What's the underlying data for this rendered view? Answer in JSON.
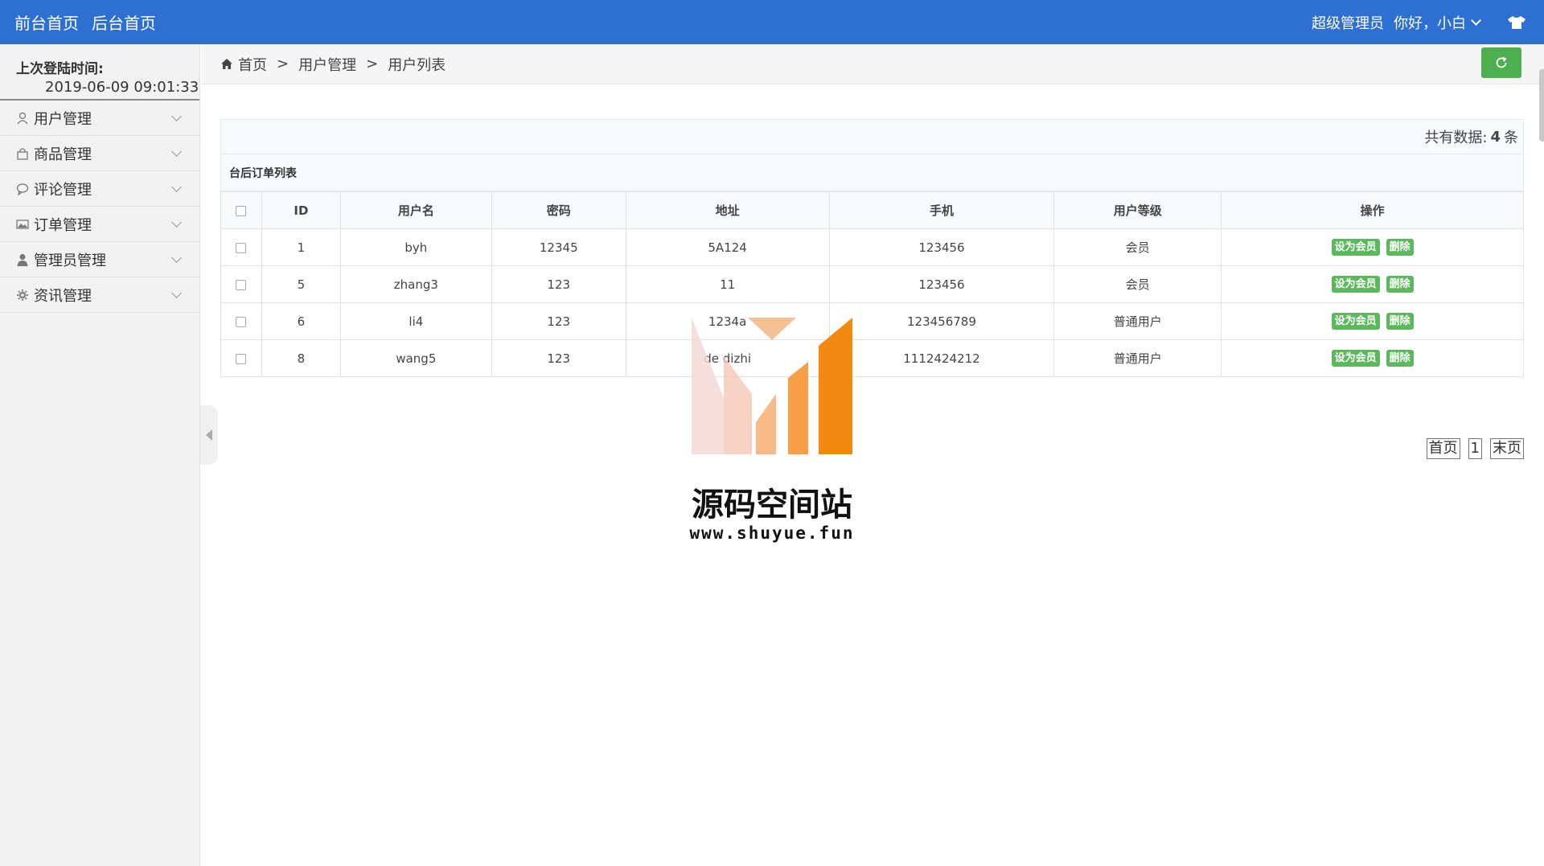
{
  "topbar": {
    "links": [
      "前台首页",
      "后台首页"
    ],
    "role": "超级管理员",
    "greeting": "你好，小白",
    "icons": {
      "user_menu": "chevron-down-icon",
      "theme": "tshirt-icon"
    },
    "color": "#2e70d1"
  },
  "sidebar": {
    "login_label": "上次登陆时间:",
    "login_time": "2019-06-09 09:01:33",
    "items": [
      {
        "label": "用户管理",
        "icon": "user-icon"
      },
      {
        "label": "商品管理",
        "icon": "bag-icon"
      },
      {
        "label": "评论管理",
        "icon": "chat-icon"
      },
      {
        "label": "订单管理",
        "icon": "image-icon"
      },
      {
        "label": "管理员管理",
        "icon": "person-icon"
      },
      {
        "label": "资讯管理",
        "icon": "gear-icon"
      }
    ]
  },
  "breadcrumb": [
    "首页",
    "用户管理",
    "用户列表"
  ],
  "breadcrumb_sep": ">",
  "panel": {
    "count_label": "共有数据:",
    "count": "4",
    "count_unit": "条",
    "title": "台后订单列表"
  },
  "table": {
    "headers": [
      "ID",
      "用户名",
      "密码",
      "地址",
      "手机",
      "用户等级",
      "操作"
    ],
    "rows": [
      {
        "id": "1",
        "username": "byh",
        "password": "12345",
        "address": "5A124",
        "phone": "123456",
        "level": "会员"
      },
      {
        "id": "5",
        "username": "zhang3",
        "password": "123",
        "address": "11",
        "phone": "123456",
        "level": "会员"
      },
      {
        "id": "6",
        "username": "li4",
        "password": "123",
        "address": "1234a",
        "phone": "123456789",
        "level": "普通用户"
      },
      {
        "id": "8",
        "username": "wang5",
        "password": "123",
        "address": "de dizhi",
        "phone": "1112424212",
        "level": "普通用户"
      }
    ],
    "action_set_member": "设为会员",
    "action_delete": "删除",
    "button_color": "#5cb85c"
  },
  "pager": [
    "首页",
    "1",
    "末页"
  ],
  "watermark": {
    "name": "源码空间站",
    "url": "www.shuyue.fun"
  }
}
